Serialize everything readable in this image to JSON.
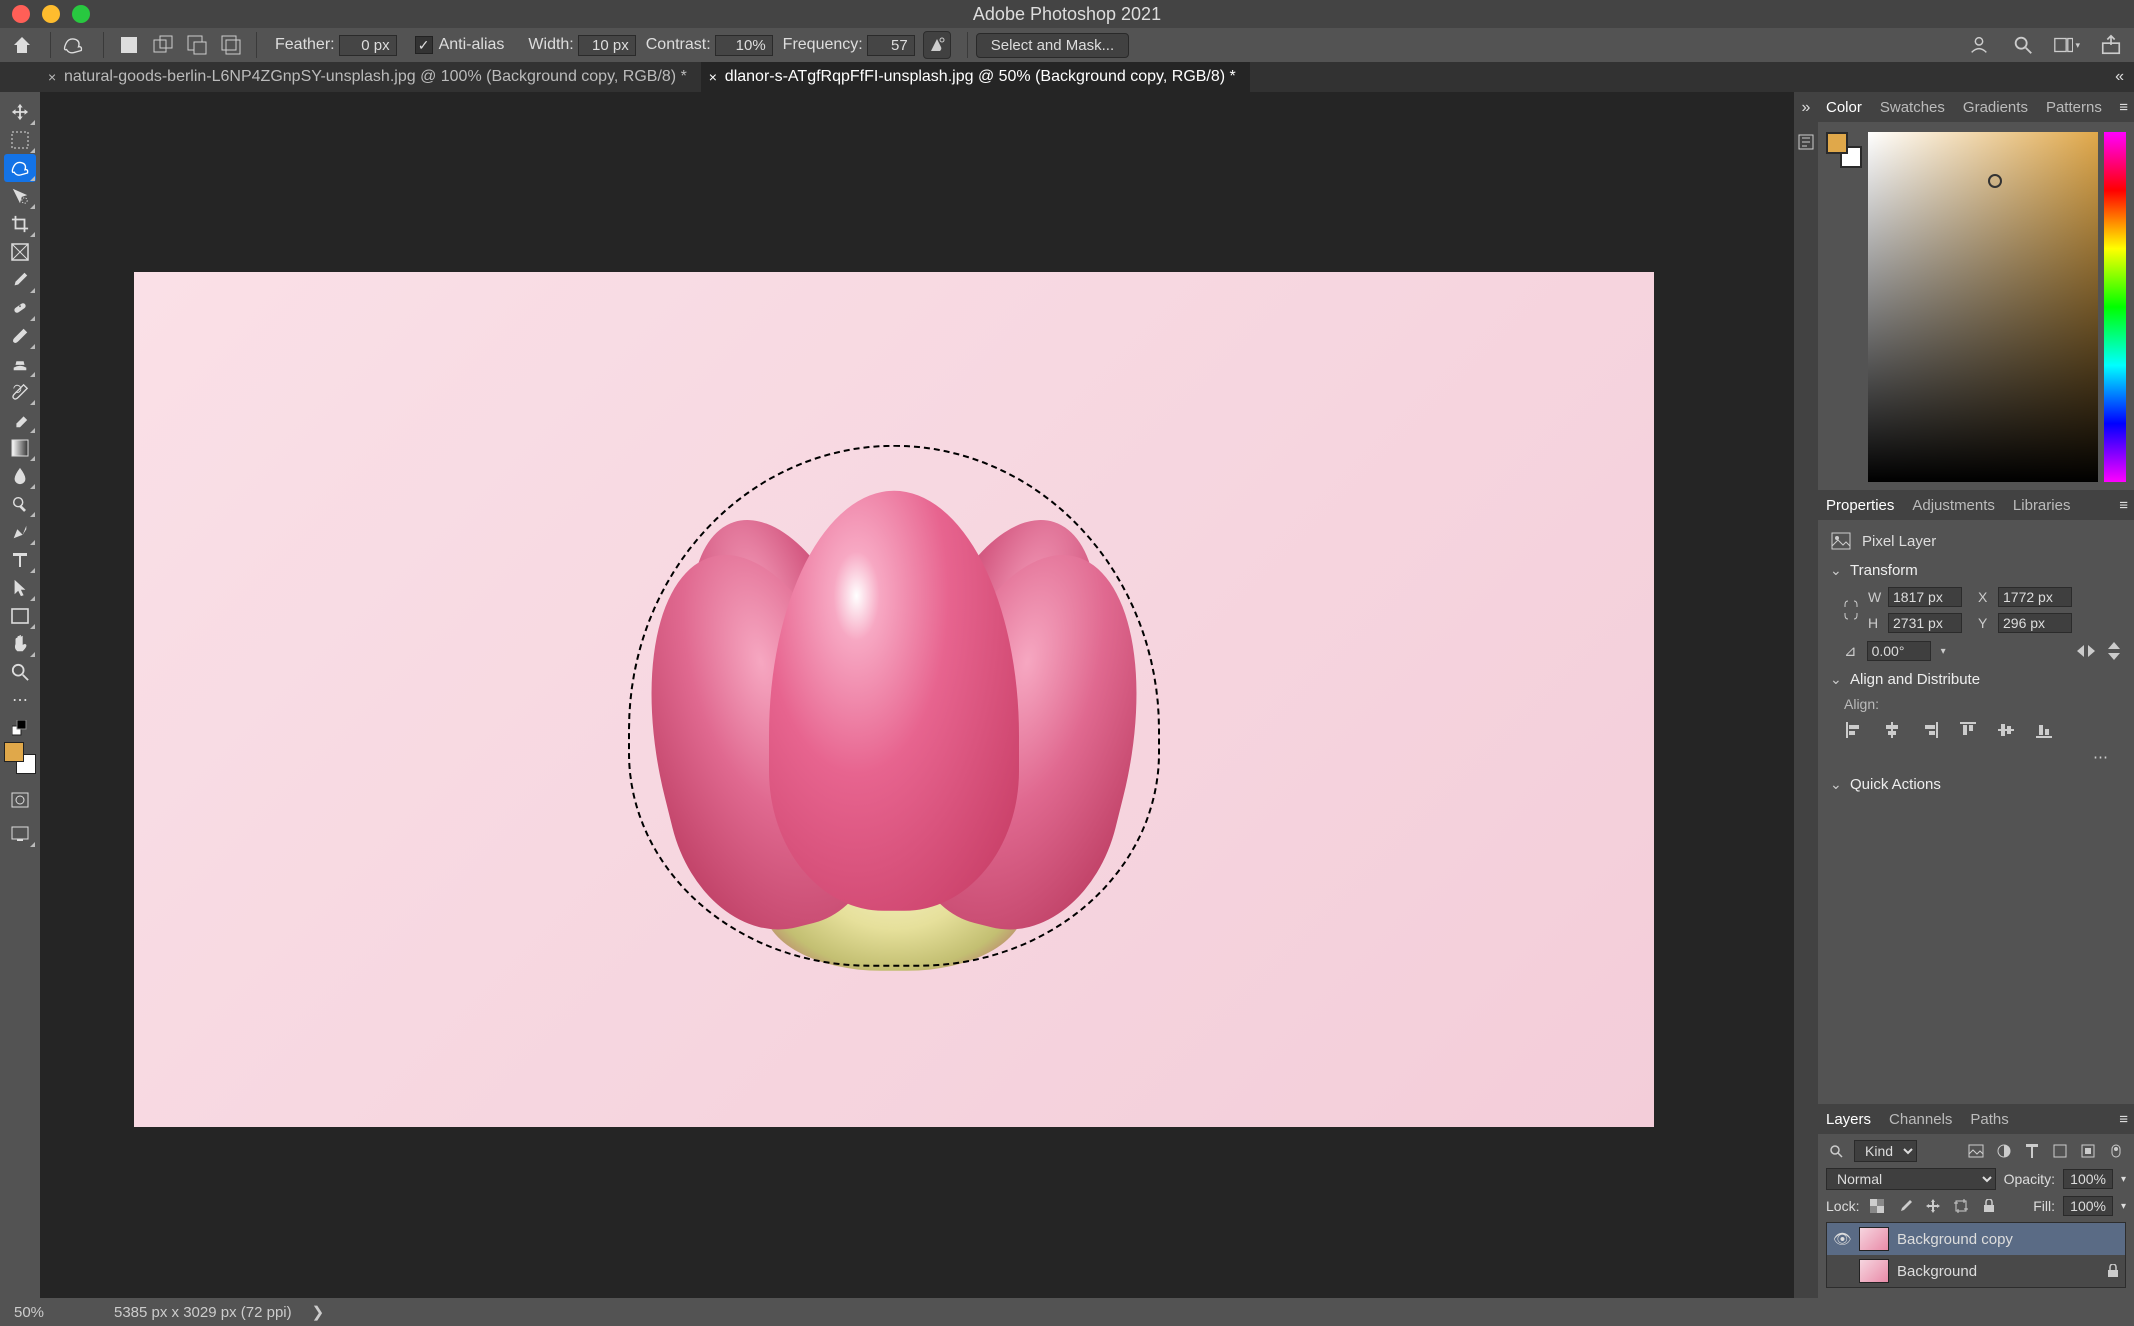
{
  "app": {
    "title": "Adobe Photoshop 2021"
  },
  "options": {
    "feather_label": "Feather:",
    "feather_value": "0 px",
    "antialias_label": "Anti-alias",
    "width_label": "Width:",
    "width_value": "10 px",
    "contrast_label": "Contrast:",
    "contrast_value": "10%",
    "frequency_label": "Frequency:",
    "frequency_value": "57",
    "select_mask_label": "Select and Mask..."
  },
  "tabs": [
    {
      "label": "natural-goods-berlin-L6NP4ZGnpSY-unsplash.jpg @ 100% (Background copy, RGB/8) *",
      "active": false
    },
    {
      "label": "dlanor-s-ATgfRqpFfFI-unsplash.jpg @ 50% (Background copy, RGB/8) *",
      "active": true
    }
  ],
  "panels": {
    "color_tabs": {
      "color": "Color",
      "swatches": "Swatches",
      "gradients": "Gradients",
      "patterns": "Patterns"
    },
    "props_tabs": {
      "properties": "Properties",
      "adjustments": "Adjustments",
      "libraries": "Libraries"
    },
    "layers_tabs": {
      "layers": "Layers",
      "channels": "Channels",
      "paths": "Paths"
    }
  },
  "properties": {
    "kind": "Pixel Layer",
    "transform": {
      "heading": "Transform",
      "w": "1817 px",
      "h": "2731 px",
      "x": "1772 px",
      "y": "296 px",
      "angle": "0.00°"
    },
    "align": {
      "heading": "Align and Distribute",
      "sub": "Align:"
    },
    "quick": {
      "heading": "Quick Actions"
    }
  },
  "layers": {
    "filter_label": "Kind",
    "blend_mode": "Normal",
    "opacity_label": "Opacity:",
    "opacity_value": "100%",
    "lock_label": "Lock:",
    "fill_label": "Fill:",
    "fill_value": "100%",
    "items": [
      {
        "name": "Background copy",
        "visible": true,
        "active": true,
        "locked": false
      },
      {
        "name": "Background",
        "visible": false,
        "active": false,
        "locked": true
      }
    ]
  },
  "status": {
    "zoom": "50%",
    "doc": "5385 px x 3029 px (72 ppi)"
  },
  "colors": {
    "fg": "#e0a84a",
    "bg": "#ffffff"
  }
}
